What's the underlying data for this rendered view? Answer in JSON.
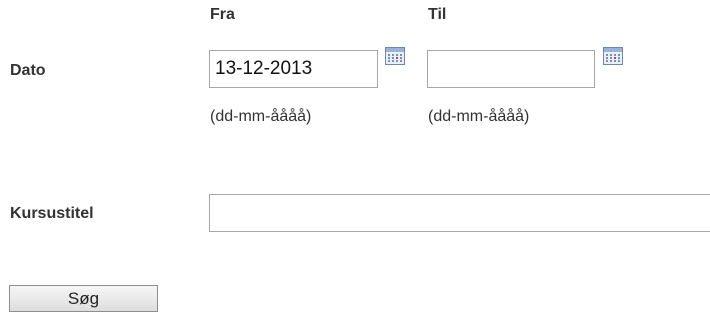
{
  "form": {
    "columns": {
      "from_label": "Fra",
      "to_label": "Til"
    },
    "date_row": {
      "label": "Dato",
      "from_value": "13-12-2013",
      "to_value": "",
      "format_hint": "(dd-mm-åååå)",
      "calendar_icon": "calendar-icon"
    },
    "title_row": {
      "label": "Kursustitel",
      "value": ""
    },
    "search_button_label": "Søg"
  }
}
